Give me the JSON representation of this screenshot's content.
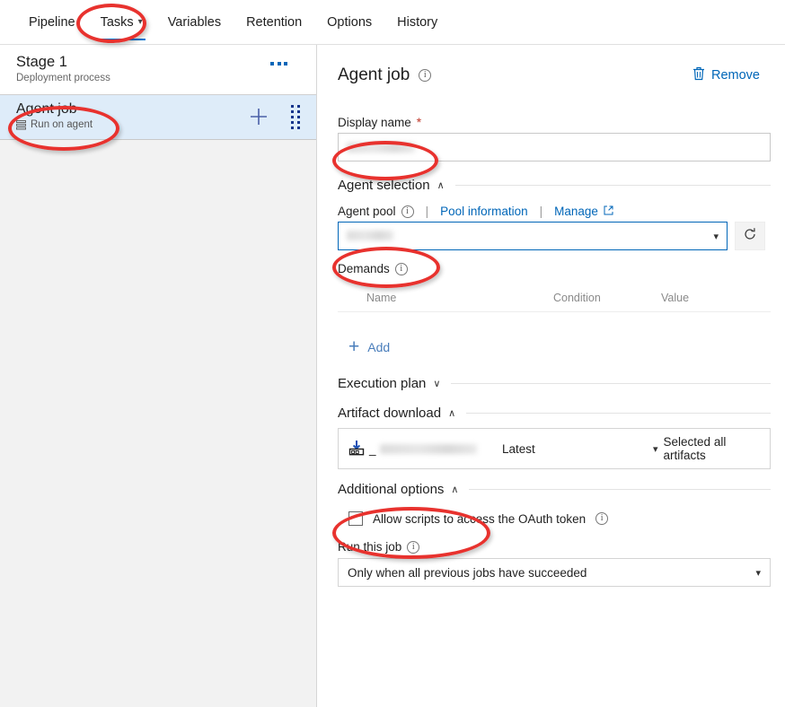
{
  "tabs": [
    {
      "label": "Pipeline",
      "active": false,
      "has_chevron": false
    },
    {
      "label": "Tasks",
      "active": true,
      "has_chevron": true
    },
    {
      "label": "Variables",
      "active": false,
      "has_chevron": false
    },
    {
      "label": "Retention",
      "active": false,
      "has_chevron": false
    },
    {
      "label": "Options",
      "active": false,
      "has_chevron": false
    },
    {
      "label": "History",
      "active": false,
      "has_chevron": false
    }
  ],
  "sidebar": {
    "stage": {
      "title": "Stage 1",
      "subtitle": "Deployment process",
      "menu_label": "..."
    },
    "job": {
      "title": "Agent job",
      "subtitle": "Run on agent",
      "add_label": "+"
    }
  },
  "panel": {
    "title": "Agent job",
    "remove_label": "Remove",
    "display_name": {
      "label": "Display name",
      "required_marker": "*",
      "value": ""
    },
    "agent_selection": {
      "heading": "Agent selection",
      "caret": "∧",
      "pool_label": "Agent pool",
      "pool_information_link": "Pool information",
      "manage_link": "Manage",
      "separator": "|",
      "pool_value": "",
      "demands_label": "Demands",
      "demands_columns": [
        "Name",
        "Condition",
        "Value"
      ],
      "demands_rows": [],
      "add_label": "Add"
    },
    "execution_plan": {
      "heading": "Execution plan",
      "caret": "∨"
    },
    "artifact_download": {
      "heading": "Artifact download",
      "caret": "∧",
      "artifact_prefix": "_",
      "artifact_name": "",
      "version": "Latest",
      "selection": "Selected all artifacts"
    },
    "additional_options": {
      "heading": "Additional options",
      "caret": "∧",
      "oauth_label": "Allow scripts to access the OAuth token",
      "oauth_checked": false,
      "run_this_job_label": "Run this job",
      "run_this_job_value": "Only when all previous jobs have succeeded"
    }
  },
  "colors": {
    "accent": "#0078d4",
    "link": "#0066b8",
    "selected_row": "#deecf9",
    "panel_bg": "#f2f2f2",
    "annotation": "#e8322e"
  }
}
